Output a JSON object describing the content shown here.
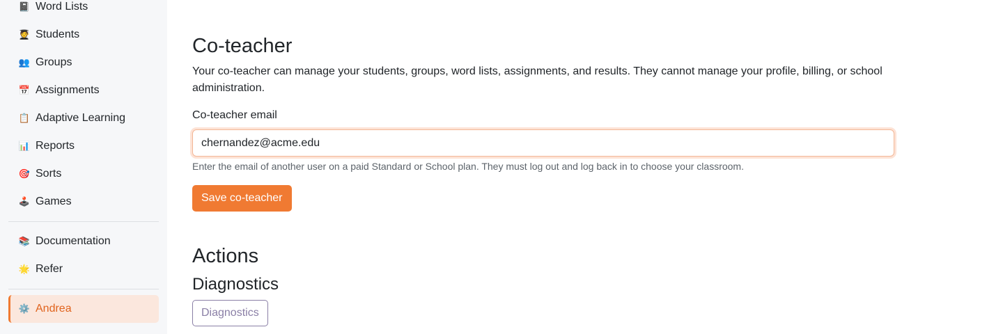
{
  "sidebar": {
    "items": [
      {
        "label": "Word Lists",
        "icon": "📓"
      },
      {
        "label": "Students",
        "icon": "🧑‍🎓"
      },
      {
        "label": "Groups",
        "icon": "👥"
      },
      {
        "label": "Assignments",
        "icon": "📅"
      },
      {
        "label": "Adaptive Learning",
        "icon": "📋"
      },
      {
        "label": "Reports",
        "icon": "📊"
      },
      {
        "label": "Sorts",
        "icon": "🎯"
      },
      {
        "label": "Games",
        "icon": "🕹️"
      }
    ],
    "secondary": [
      {
        "label": "Documentation",
        "icon": "📚"
      },
      {
        "label": "Refer",
        "icon": "🌟"
      }
    ],
    "user": {
      "label": "Andrea",
      "icon": "⚙️"
    }
  },
  "coteacher": {
    "title": "Co-teacher",
    "description": "Your co-teacher can manage your students, groups, word lists, assignments, and results. They cannot manage your profile, billing, or school administration.",
    "email_label": "Co-teacher email",
    "email_value": "chernandez@acme.edu",
    "help_text": "Enter the email of another user on a paid Standard or School plan. They must log out and log back in to choose your classroom.",
    "save_label": "Save co-teacher"
  },
  "actions": {
    "title": "Actions",
    "diagnostics_title": "Diagnostics",
    "diagnostics_button": "Diagnostics"
  },
  "colors": {
    "accent": "#f07a32",
    "active_bg": "#fbe7dd",
    "sidebar_bg": "#f6f7f9",
    "outline_button": "#8a7fa6"
  }
}
